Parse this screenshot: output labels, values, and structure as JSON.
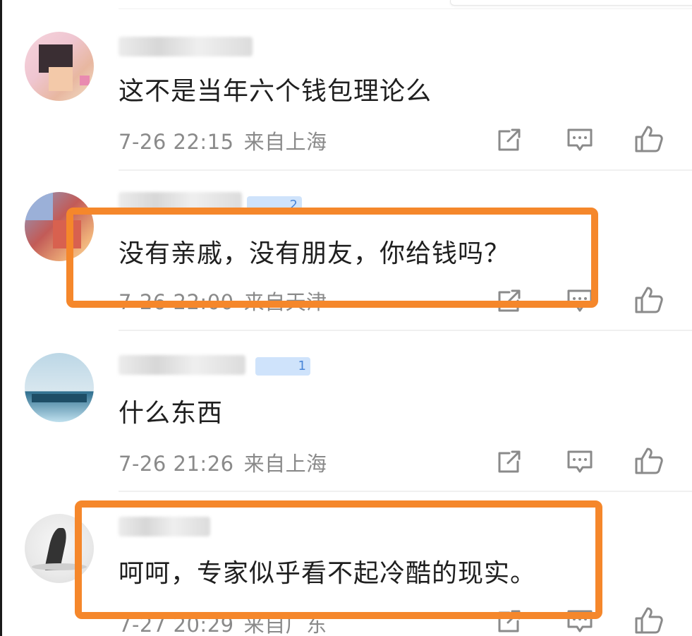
{
  "comments": [
    {
      "text": "这不是当年六个钱包理论么",
      "date": "7-26 22:15",
      "location": "来自上海",
      "has_badge": false
    },
    {
      "text": "没有亲戚，没有朋友，你给钱吗？",
      "date": "7-26 22:00",
      "location": "来自天津",
      "badge": "2",
      "highlighted": true
    },
    {
      "text": "什么东西",
      "date": "7-26 21:26",
      "location": "来自上海",
      "badge": "1"
    },
    {
      "text": "呵呵，专家似乎看不起冷酷的现实。",
      "date": "7-27 20:29",
      "location": "来自广东",
      "highlighted": true
    }
  ],
  "icons": {
    "share": "share-icon",
    "reply": "reply-icon",
    "like": "like-icon"
  },
  "colors": {
    "highlight": "#f5872b",
    "text": "#1f1f1f",
    "meta": "#8a8a8a",
    "badge_bg": "#cfe3fb",
    "badge_text": "#4a86d8"
  }
}
